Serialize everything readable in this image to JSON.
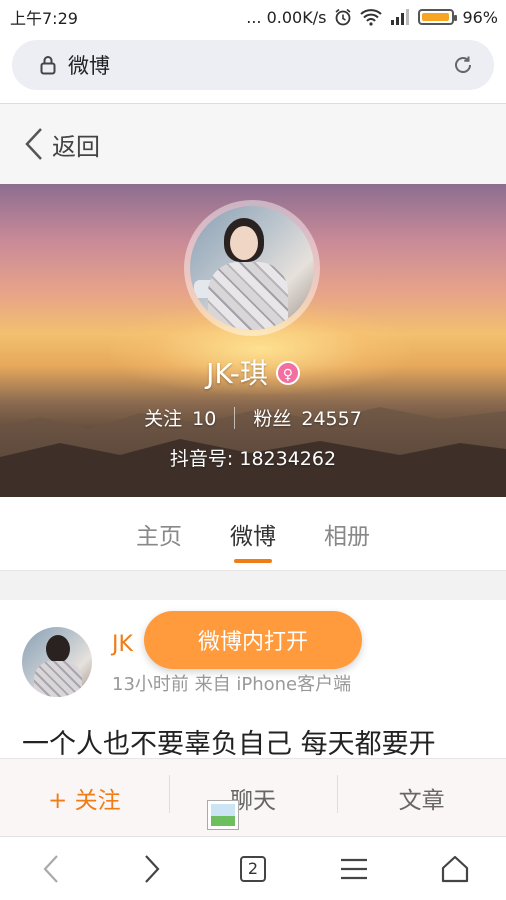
{
  "status_bar": {
    "time": "上午7:29",
    "network_speed": "... 0.00K/s",
    "battery_percent": "96%",
    "battery_level": 0.96
  },
  "browser": {
    "url_title": "微博",
    "tab_count": "2"
  },
  "nav": {
    "back_label": "返回"
  },
  "profile": {
    "username": "JK-琪",
    "gender_symbol": "♀",
    "follow_label": "关注",
    "follow_count": "10",
    "fans_label": "粉丝",
    "fans_count": "24557",
    "douyin_id": "抖音号: 18234262"
  },
  "tabs": [
    {
      "label": "主页",
      "active": false
    },
    {
      "label": "微博",
      "active": true
    },
    {
      "label": "相册",
      "active": false
    }
  ],
  "post": {
    "author": "JK",
    "meta": "13小时前 来自 iPhone客户端",
    "text": "一个人也不要辜负自己 每天都要开"
  },
  "open_in_app": "微博内打开",
  "actions": {
    "follow": "关注",
    "follow_icon": "+",
    "chat": "聊天",
    "article": "文章"
  },
  "colors": {
    "accent": "#f07c18",
    "open_button": "#ff9a3d",
    "gender_badge": "#f36fa0"
  }
}
